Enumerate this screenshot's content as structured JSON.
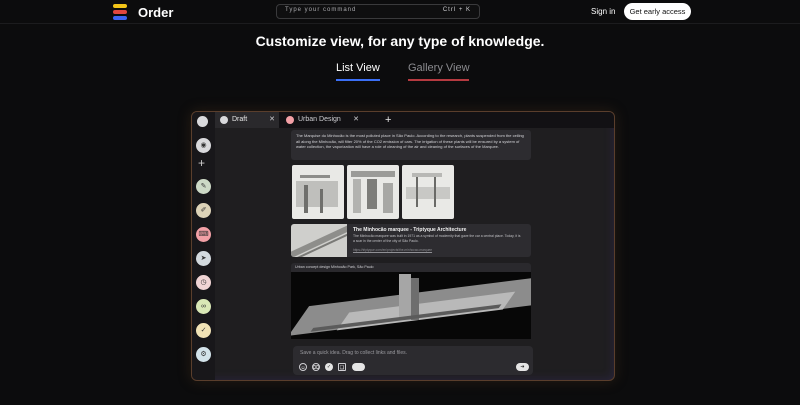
{
  "nav": {
    "brand": "Order",
    "command_placeholder": "Type your command",
    "command_shortcut": "Ctrl + K",
    "signin": "Sign in",
    "cta": "Get early access"
  },
  "hero": {
    "headline": "Customize view, for any type of knowledge.",
    "tabs": [
      {
        "label": "List View",
        "active": true,
        "underline_color": "#3b6ff5"
      },
      {
        "label": "Gallery View",
        "active": false,
        "underline_color": "#e0464d"
      }
    ]
  },
  "app": {
    "tabs": [
      {
        "label": "Draft",
        "icon": "circle-dot-icon"
      },
      {
        "label": "Urban Design",
        "icon": "tag-icon"
      }
    ],
    "new_tab_icon": "plus-icon",
    "sidebar_icons": [
      "eye-icon",
      "plus-icon",
      "pencil-icon",
      "brush-icon",
      "keyboard-icon",
      "rocket-icon",
      "alarm-icon",
      "link-icon",
      "check-icon",
      "gear-icon"
    ],
    "note": "The Marquise du Minhocão is the most polluted place in São Paulo. According to the research, plants suspended from the ceiling all along the Minhocão, will filter 20% of the CO2 emission of cars. The irrigation of these plants will be ensured by a system of water collection, the vaporization will have a role of cleaning of the air and cleaning of the surfaces of the Marquee.",
    "link": {
      "title": "The Minhocão marquee - Triptyque Architecture",
      "description": "The Minhocão marquee was built in 1971 as a symbol of modernity that gave the car a central place. Today, it is a scar in the center of the city of São Paulo.",
      "url": "https://triptyque.com/en/projects/the-minhocao-marquee"
    },
    "render_caption": "Urban concept design Minhocão Park, São Paulo",
    "composer_placeholder": "Save a quick idea. Drag to collect links and files.",
    "composer_tools": [
      "emoji-icon",
      "attach-icon",
      "check-icon",
      "crop-icon",
      "pill-icon"
    ],
    "send_icon": "send-arrow-icon"
  },
  "colors": {
    "accent_blue": "#3b6ff5",
    "accent_red": "#e0464d",
    "logo": [
      "#f2c417",
      "#e2463d",
      "#3e63f0"
    ]
  }
}
